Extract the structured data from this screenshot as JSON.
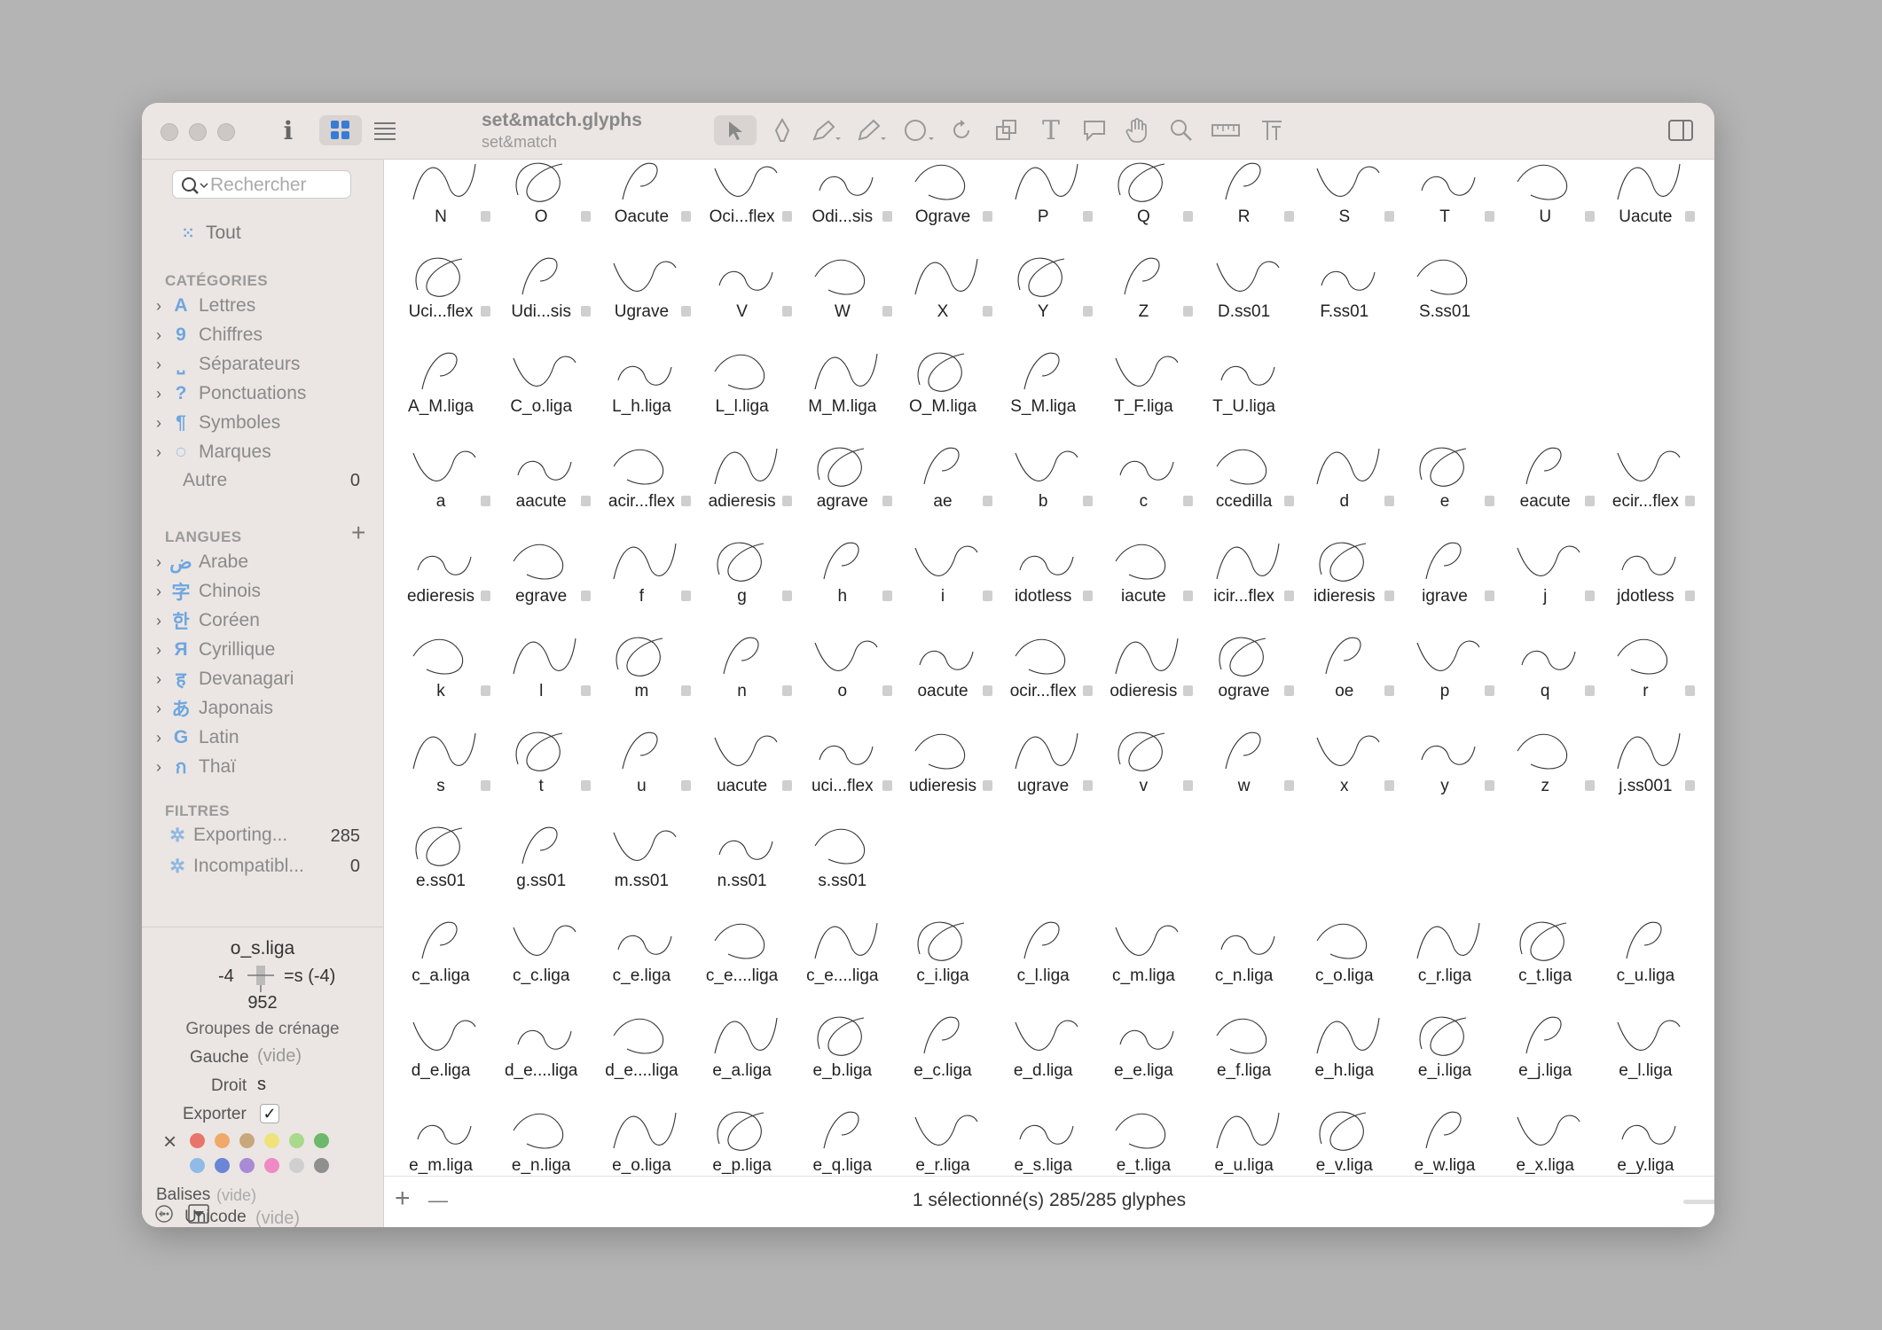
{
  "window": {
    "title": "set&match.glyphs",
    "subtitle": "set&match"
  },
  "toolbar": {
    "tools": [
      "select-arrow-icon",
      "draw-icon",
      "pen-icon",
      "pencil-icon",
      "shape-icon",
      "rotate-icon",
      "scale-icon",
      "text-icon",
      "annotation-icon",
      "hand-icon",
      "zoom-icon",
      "measure-icon",
      "kerning-icon"
    ]
  },
  "sidebar": {
    "search_placeholder": "Rechercher",
    "all_label": "Tout",
    "categories_header": "CATÉGORIES",
    "categories": [
      {
        "icon": "A",
        "label": "Lettres"
      },
      {
        "icon": "9",
        "label": "Chiffres"
      },
      {
        "icon": "⎵",
        "label": "Séparateurs"
      },
      {
        "icon": "?",
        "label": "Ponctuations"
      },
      {
        "icon": "¶",
        "label": "Symboles"
      },
      {
        "icon": "◌",
        "label": "Marques"
      }
    ],
    "other_label": "Autre",
    "other_count": "0",
    "languages_header": "LANGUES",
    "languages": [
      {
        "icon": "ض",
        "label": "Arabe"
      },
      {
        "icon": "字",
        "label": "Chinois"
      },
      {
        "icon": "한",
        "label": "Coréen"
      },
      {
        "icon": "Я",
        "label": "Cyrillique"
      },
      {
        "icon": "ह",
        "label": "Devanagari"
      },
      {
        "icon": "あ",
        "label": "Japonais"
      },
      {
        "icon": "G",
        "label": "Latin"
      },
      {
        "icon": "ก",
        "label": "Thaï"
      }
    ],
    "filters_header": "FILTRES",
    "filters": [
      {
        "label": "Exporting...",
        "count": "285"
      },
      {
        "label": "Incompatibl...",
        "count": "0"
      }
    ]
  },
  "inspector": {
    "glyph_name": "o_s.liga",
    "left_kern": "-4",
    "right_kern": "=s (-4)",
    "width": "952",
    "kerning_groups_label": "Groupes de crénage",
    "left_label": "Gauche",
    "left_value": "(vide)",
    "right_label": "Droit",
    "right_value": "s",
    "export_label": "Exporter",
    "tags_label": "Balises",
    "tags_value": "(vide)",
    "unicode_label": "Unicode",
    "unicode_value": "(vide)",
    "colors": [
      "#e8756a",
      "#f0a96a",
      "#c9a77c",
      "#efe27a",
      "#a9d98a",
      "#6db86a",
      "#8fbbe6",
      "#6b86d6",
      "#a98ad6",
      "#ef8ac4",
      "#cfcfcf",
      "#8f8f8f"
    ]
  },
  "grid": {
    "rows": [
      [
        "N",
        "O",
        "Oacute",
        "Oci...flex",
        "Odi...sis",
        "Ograve",
        "P",
        "Q",
        "R",
        "S",
        "T",
        "U",
        "Uacute"
      ],
      [
        "Uci...flex",
        "Udi...sis",
        "Ugrave",
        "V",
        "W",
        "X",
        "Y",
        "Z",
        "D.ss01",
        "F.ss01",
        "S.ss01"
      ],
      [
        "A_M.liga",
        "C_o.liga",
        "L_h.liga",
        "L_l.liga",
        "M_M.liga",
        "O_M.liga",
        "S_M.liga",
        "T_F.liga",
        "T_U.liga"
      ],
      [
        "a",
        "aacute",
        "acir...flex",
        "adieresis",
        "agrave",
        "ae",
        "b",
        "c",
        "ccedilla",
        "d",
        "e",
        "eacute",
        "ecir...flex"
      ],
      [
        "edieresis",
        "egrave",
        "f",
        "g",
        "h",
        "i",
        "idotless",
        "iacute",
        "icir...flex",
        "idieresis",
        "igrave",
        "j",
        "jdotless"
      ],
      [
        "k",
        "l",
        "m",
        "n",
        "o",
        "oacute",
        "ocir...flex",
        "odieresis",
        "ograve",
        "oe",
        "p",
        "q",
        "r"
      ],
      [
        "s",
        "t",
        "u",
        "uacute",
        "uci...flex",
        "udieresis",
        "ugrave",
        "v",
        "w",
        "x",
        "y",
        "z",
        "j.ss001"
      ],
      [
        "e.ss01",
        "g.ss01",
        "m.ss01",
        "n.ss01",
        "s.ss01"
      ],
      [
        "c_a.liga",
        "c_c.liga",
        "c_e.liga",
        "c_e....liga",
        "c_e....liga",
        "c_i.liga",
        "c_l.liga",
        "c_m.liga",
        "c_n.liga",
        "c_o.liga",
        "c_r.liga",
        "c_t.liga",
        "c_u.liga"
      ],
      [
        "d_e.liga",
        "d_e....liga",
        "d_e....liga",
        "e_a.liga",
        "e_b.liga",
        "e_c.liga",
        "e_d.liga",
        "e_e.liga",
        "e_f.liga",
        "e_h.liga",
        "e_i.liga",
        "e_j.liga",
        "e_l.liga"
      ],
      [
        "e_m.liga",
        "e_n.liga",
        "e_o.liga",
        "e_p.liga",
        "e_q.liga",
        "e_r.liga",
        "e_s.liga",
        "e_t.liga",
        "e_u.liga",
        "e_v.liga",
        "e_w.liga",
        "e_x.liga",
        "e_y.liga"
      ]
    ]
  },
  "status": {
    "text": "1 sélectionné(s) 285/285 glyphes",
    "add": "+",
    "remove": "—"
  }
}
